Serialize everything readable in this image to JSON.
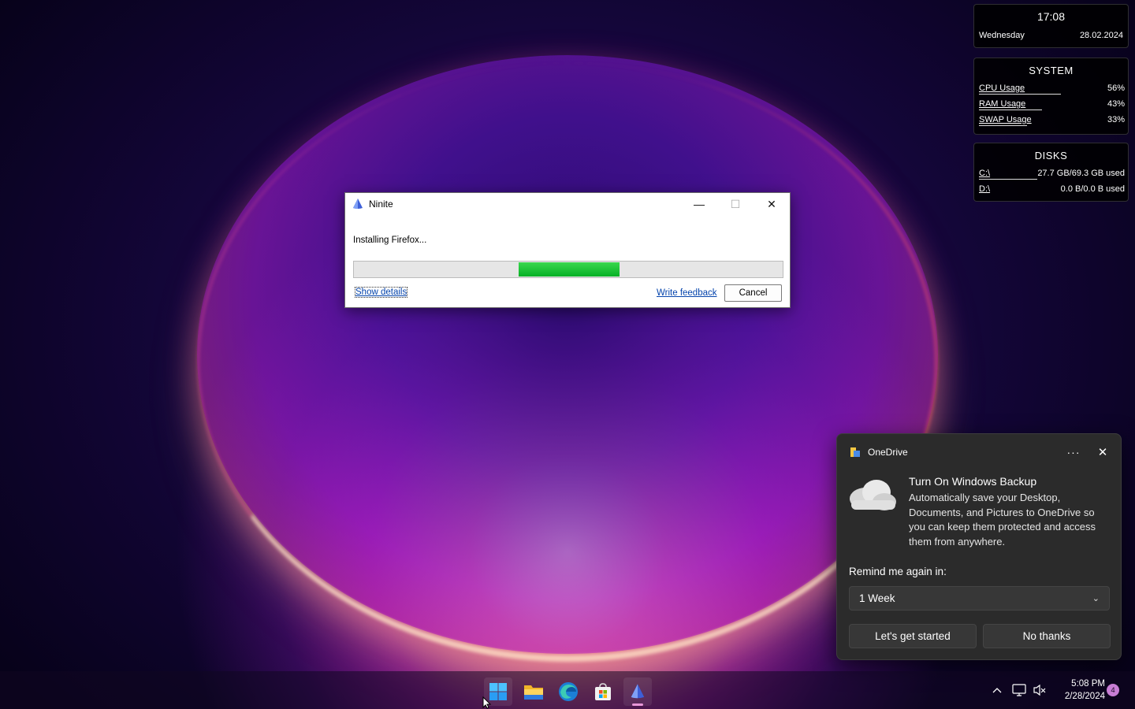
{
  "clock_widget": {
    "time": "17:08",
    "day": "Wednesday",
    "date": "28.02.2024"
  },
  "system_widget": {
    "title": "SYSTEM",
    "rows": [
      {
        "label": "CPU Usage",
        "value": "56%",
        "fraction": 0.56
      },
      {
        "label": "RAM Usage",
        "value": "43%",
        "fraction": 0.43
      },
      {
        "label": "SWAP Usage",
        "value": "33%",
        "fraction": 0.33
      }
    ]
  },
  "disks_widget": {
    "title": "DISKS",
    "rows": [
      {
        "label": "C:\\",
        "value": "27.7 GB/69.3 GB used",
        "fraction": 0.4
      },
      {
        "label": "D:\\",
        "value": "0.0 B/0.0 B used",
        "fraction": 0.0
      }
    ]
  },
  "ninite": {
    "title": "Ninite",
    "status": "Installing Firefox...",
    "progress_start": 0.385,
    "progress_end": 0.62,
    "show_details": "Show details",
    "write_feedback": "Write feedback",
    "cancel": "Cancel",
    "minimize_glyph": "—",
    "maximize_glyph": "☐",
    "close_glyph": "✕"
  },
  "onedrive_toast": {
    "app_name": "OneDrive",
    "more_glyph": "···",
    "close_glyph": "✕",
    "title": "Turn On Windows Backup",
    "body": "Automatically save your Desktop, Documents, and Pictures to OneDrive so you can keep them protected and access them from anywhere.",
    "remind_label": "Remind me again in:",
    "remind_value": "1 Week",
    "chevron_glyph": "⌄",
    "primary_button": "Let's get started",
    "secondary_button": "No thanks"
  },
  "taskbar": {
    "apps": [
      {
        "name": "Start"
      },
      {
        "name": "File Explorer"
      },
      {
        "name": "Microsoft Edge"
      },
      {
        "name": "Microsoft Store"
      },
      {
        "name": "Ninite"
      }
    ],
    "time": "5:08 PM",
    "date": "2/28/2024",
    "notification_count": "4",
    "tray_chevron_glyph": "^"
  },
  "colors": {
    "progress_green": "#06b025",
    "link_blue": "#0645ad",
    "toast_bg": "#2b2b2b",
    "badge_purple": "#c77dd4"
  }
}
